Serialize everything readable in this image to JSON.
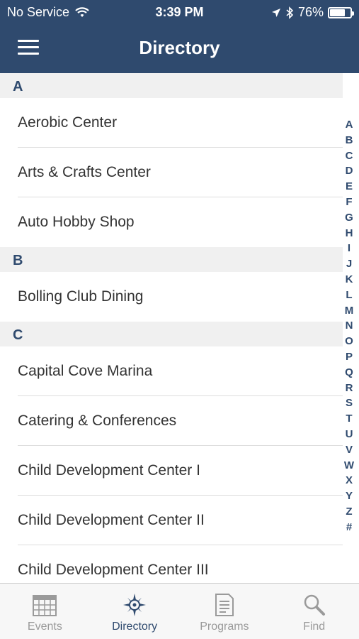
{
  "status_bar": {
    "carrier": "No Service",
    "time": "3:39 PM",
    "battery_text": "76%",
    "battery_level": 0.76
  },
  "nav": {
    "title": "Directory"
  },
  "sections": [
    {
      "letter": "A",
      "items": [
        "Aerobic Center",
        "Arts & Crafts Center",
        "Auto Hobby Shop"
      ]
    },
    {
      "letter": "B",
      "items": [
        "Bolling Club Dining"
      ]
    },
    {
      "letter": "C",
      "items": [
        "Capital Cove Marina",
        "Catering & Conferences",
        "Child Development Center I",
        "Child Development Center II",
        "Child Development Center III"
      ]
    }
  ],
  "index_letters": [
    "A",
    "B",
    "C",
    "D",
    "E",
    "F",
    "G",
    "H",
    "I",
    "J",
    "K",
    "L",
    "M",
    "N",
    "O",
    "P",
    "Q",
    "R",
    "S",
    "T",
    "U",
    "V",
    "W",
    "X",
    "Y",
    "Z",
    "#"
  ],
  "tabs": [
    {
      "label": "Events",
      "icon": "calendar-icon",
      "active": false
    },
    {
      "label": "Directory",
      "icon": "compass-icon",
      "active": true
    },
    {
      "label": "Programs",
      "icon": "document-icon",
      "active": false
    },
    {
      "label": "Find",
      "icon": "search-icon",
      "active": false
    }
  ],
  "colors": {
    "header": "#2f4a6e",
    "accent": "#2f4a6e",
    "inactive": "#9a9a9a"
  }
}
